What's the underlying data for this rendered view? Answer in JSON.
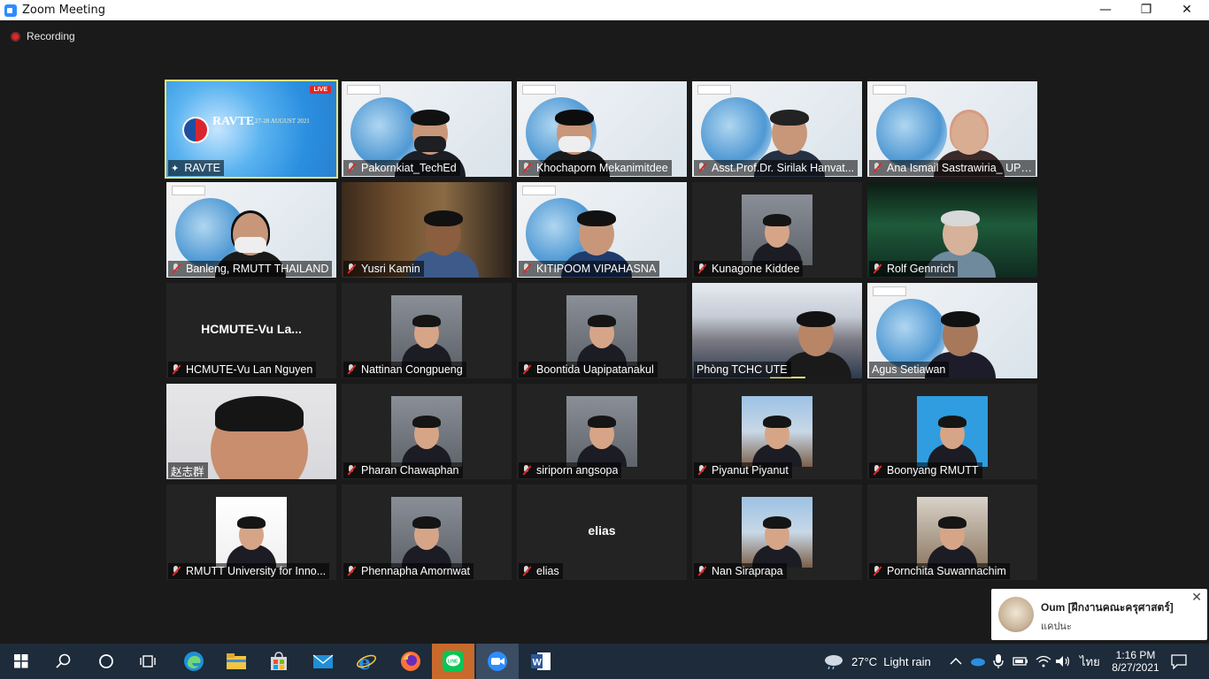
{
  "window": {
    "title": "Zoom Meeting",
    "minimize": "—",
    "restore": "❐",
    "close": "✕"
  },
  "recording": {
    "label": "Recording"
  },
  "participants": [
    {
      "name": "RAVTE",
      "muted": false,
      "kind": "slide-live",
      "badge": "LIVE",
      "slide_title": "RAVTE",
      "slide_date": "27-28 AUGUST 2021"
    },
    {
      "name": "Pakornkiat_TechEd",
      "muted": true,
      "kind": "slide-person"
    },
    {
      "name": "Khochaporn Mekanimitdee",
      "muted": true,
      "kind": "slide-person"
    },
    {
      "name": "Asst.Prof.Dr. Sirilak Hanvat...",
      "muted": true,
      "kind": "slide-person"
    },
    {
      "name": "Ana Ismail Sastrawiria_ UPI ...",
      "muted": true,
      "kind": "slide-person"
    },
    {
      "name": "Banleng, RMUTT THAILAND",
      "muted": true,
      "kind": "slide-person"
    },
    {
      "name": "Yusri Kamin",
      "muted": true,
      "kind": "room-person"
    },
    {
      "name": "KITIPOOM VIPAHASNA",
      "muted": true,
      "kind": "slide-person"
    },
    {
      "name": "Kunagone Kiddee",
      "muted": true,
      "kind": "photo"
    },
    {
      "name": "Rolf Gennrich",
      "muted": true,
      "kind": "aurora-person"
    },
    {
      "name": "HCMUTE-Vu Lan Nguyen",
      "muted": true,
      "kind": "text",
      "display": "HCMUTE-Vu  La..."
    },
    {
      "name": "Nattinan Congpueng",
      "muted": true,
      "kind": "photo"
    },
    {
      "name": "Boontida Uapipatanakul",
      "muted": true,
      "kind": "photo"
    },
    {
      "name": "Phòng TCHC UTE",
      "muted": false,
      "kind": "conf-person",
      "speaking": true
    },
    {
      "name": "Agus Setiawan",
      "muted": false,
      "kind": "slide-person"
    },
    {
      "name": "赵志群",
      "muted": false,
      "kind": "closeup"
    },
    {
      "name": "Pharan Chawaphan",
      "muted": true,
      "kind": "photo"
    },
    {
      "name": "siriporn angsopa",
      "muted": true,
      "kind": "photo"
    },
    {
      "name": "Piyanut Piyanut",
      "muted": true,
      "kind": "photo-outdoor"
    },
    {
      "name": "Boonyang RMUTT",
      "muted": true,
      "kind": "photo-blue"
    },
    {
      "name": "RMUTT University for Inno...",
      "muted": true,
      "kind": "photo-white"
    },
    {
      "name": "Phennapha Amornwat",
      "muted": true,
      "kind": "photo"
    },
    {
      "name": "elias",
      "muted": true,
      "kind": "text",
      "display": "elias"
    },
    {
      "name": "Nan Siraprapa",
      "muted": true,
      "kind": "photo-outdoor"
    },
    {
      "name": "Pornchita Suwannachim",
      "muted": true,
      "kind": "photo-room"
    }
  ],
  "notification": {
    "from": "Oum [ฝึกงานคณะครุศาสตร์]",
    "message": "แคปนะ",
    "close": "✕"
  },
  "taskbar": {
    "weather": "27°C  Light rain",
    "language": "ไทย",
    "time": "1:16 PM",
    "date": "8/27/2021"
  },
  "colors": {
    "active_speaker": "#e9e57a",
    "taskbar": "#1d2b3a",
    "muted": "#e02828"
  }
}
